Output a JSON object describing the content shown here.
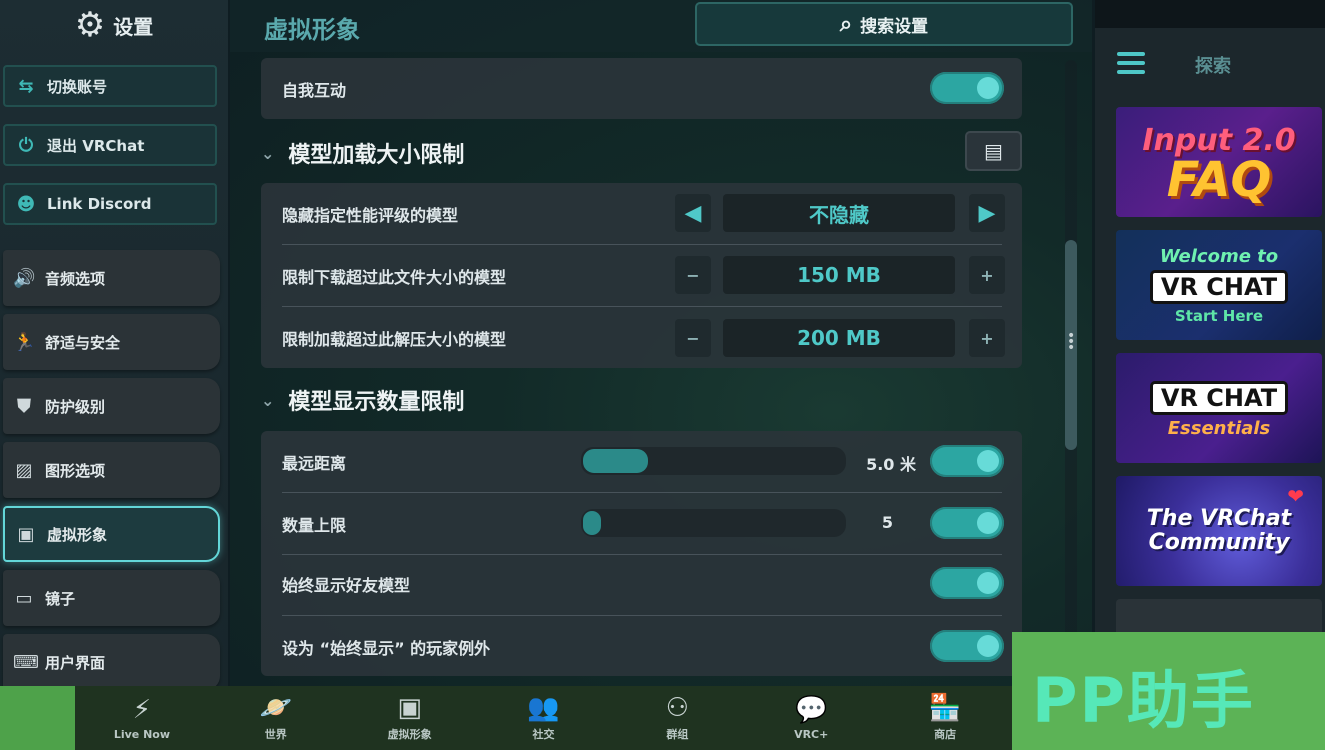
{
  "sidebar": {
    "title": "设置",
    "icon": "gear-icon",
    "buttons": [
      {
        "label": "切换账号",
        "icon": "switch-account-icon"
      },
      {
        "label": "退出 VRChat",
        "icon": "power-icon"
      },
      {
        "label": "Link Discord",
        "icon": "discord-icon"
      }
    ],
    "items": [
      {
        "label": "音频选项",
        "icon": "speaker-icon"
      },
      {
        "label": "舒适与安全",
        "icon": "running-icon"
      },
      {
        "label": "防护级别",
        "icon": "shield-icon"
      },
      {
        "label": "图形选项",
        "icon": "image-icon"
      },
      {
        "label": "虚拟形象",
        "icon": "avatar-icon",
        "active": true
      },
      {
        "label": "镜子",
        "icon": "mirror-icon"
      },
      {
        "label": "用户界面",
        "icon": "keyboard-icon"
      }
    ]
  },
  "header": {
    "title": "虚拟形象",
    "search_label": "搜索设置"
  },
  "main": {
    "self_interact": {
      "label": "自我互动",
      "on": true
    },
    "load_limit": {
      "title": "模型加载大小限制",
      "rows": [
        {
          "label": "隐藏指定性能评级的模型",
          "value": "不隐藏"
        },
        {
          "label": "限制下载超过此文件大小的模型",
          "value": "150 MB",
          "minus": "−",
          "plus": "+"
        },
        {
          "label": "限制加载超过此解压大小的模型",
          "value": "200 MB",
          "minus": "−",
          "plus": "+"
        }
      ]
    },
    "display_limit": {
      "title": "模型显示数量限制",
      "rows": [
        {
          "label": "最远距离",
          "value": "5.0 米",
          "fill": 0.25,
          "on": true
        },
        {
          "label": "数量上限",
          "value": "5",
          "fill": 0.06,
          "on": true
        },
        {
          "label": "始终显示好友模型",
          "on": true
        },
        {
          "label": "设为 “始终显示” 的玩家例外",
          "on": true
        }
      ]
    }
  },
  "right_panel": {
    "title": "探索",
    "promos": [
      {
        "line1": "Input 2.0",
        "line2": "FAQ"
      },
      {
        "line1": "Welcome to",
        "badge": "VR CHAT",
        "line2": "Start Here"
      },
      {
        "badge": "VR CHAT",
        "line2": "Essentials"
      },
      {
        "line1": "The VRChat",
        "line2": "Community"
      }
    ]
  },
  "bottom_nav": [
    {
      "label": "Live Now",
      "icon": "lightning-icon"
    },
    {
      "label": "世界",
      "icon": "planet-icon"
    },
    {
      "label": "虚拟形象",
      "icon": "avatar-icon"
    },
    {
      "label": "社交",
      "icon": "people-icon"
    },
    {
      "label": "群组",
      "icon": "group-icon"
    },
    {
      "label": "VRC+",
      "icon": "vrc-plus-icon"
    },
    {
      "label": "商店",
      "icon": "store-icon"
    }
  ],
  "watermark": "PP助手",
  "colors": {
    "accent": "#4fc9c8",
    "toggle_on": "#2ca6a2",
    "sidebar_bg": "#1d2d33",
    "nav_bg": "#1f3320",
    "watermark_bg": "#5cb356"
  }
}
